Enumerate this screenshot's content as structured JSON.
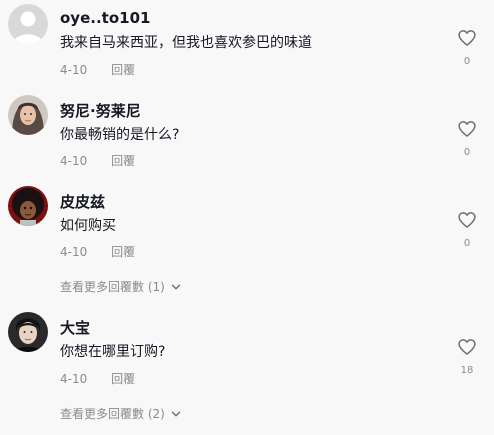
{
  "comments": [
    {
      "username": "oye..to101",
      "text": "我来自马来西亚，但我也喜欢参巴的味道",
      "date": "4-10",
      "reply_label": "回覆",
      "likes": "0",
      "avatar": "default-avatar"
    },
    {
      "username": "努尼·努莱尼",
      "text": "你最畅销的是什么?",
      "date": "4-10",
      "reply_label": "回覆",
      "likes": "0",
      "avatar": "hijab-woman-avatar"
    },
    {
      "username": "皮皮兹",
      "text": "如何购买",
      "date": "4-10",
      "reply_label": "回覆",
      "likes": "0",
      "avatar": "afro-avatar",
      "more_replies": "查看更多回覆數 (1)"
    },
    {
      "username": "大宝",
      "text": "你想在哪里订购?",
      "date": "4-10",
      "reply_label": "回覆",
      "likes": "18",
      "avatar": "man-avatar",
      "more_replies": "查看更多回覆數 (2)"
    }
  ],
  "colors": {
    "background": "#f8f8f8",
    "username": "#161823",
    "meta": "#8a8b91"
  }
}
